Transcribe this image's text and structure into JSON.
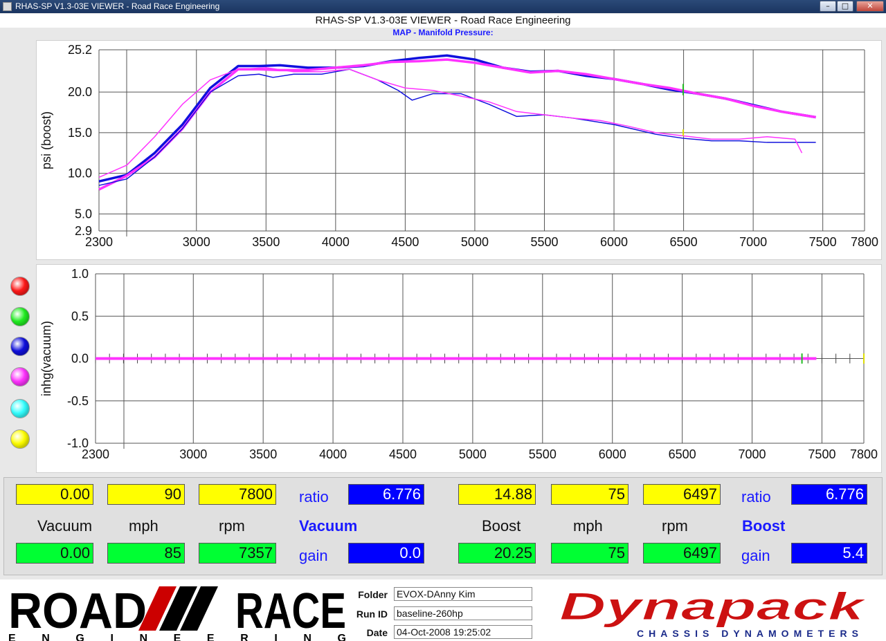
{
  "window": {
    "title": "RHAS-SP V1.3-03E VIEWER - Road Race Engineering",
    "icon": "app-icon",
    "controls": [
      "minimize",
      "maximize",
      "close"
    ]
  },
  "header": {
    "title": "RHAS-SP V1.3-03E VIEWER - Road Race Engineering",
    "subtitle": "MAP - Manifold Pressure:"
  },
  "legend_swatches": [
    {
      "color": "#ff1a1a",
      "name": "red"
    },
    {
      "color": "#22ee22",
      "name": "green"
    },
    {
      "color": "#1010dd",
      "name": "blue"
    },
    {
      "color": "#ff33ff",
      "name": "magenta"
    },
    {
      "color": "#33ffff",
      "name": "cyan"
    },
    {
      "color": "#ffff00",
      "name": "yellow"
    }
  ],
  "chart_data": [
    {
      "type": "line",
      "title": "MAP - Manifold Pressure:",
      "ylabel": "psi (boost)",
      "xlabel": "",
      "xlim": [
        2300,
        7800
      ],
      "ylim": [
        2.9,
        25.2
      ],
      "xticks": [
        "2300",
        "3000",
        "3500",
        "4000",
        "4500",
        "5000",
        "5500",
        "6000",
        "6500",
        "7000",
        "7500",
        "7800"
      ],
      "yticks": [
        "25.2",
        "20.0",
        "15.0",
        "10.0",
        "5.0",
        "2.9"
      ],
      "grid": true,
      "series": [
        {
          "color": "#1010dd",
          "width": 3.5,
          "x": [
            2300,
            2500,
            2700,
            2900,
            3100,
            3300,
            3450,
            3600,
            3800,
            4000,
            4200,
            4400,
            4600,
            4800,
            5000,
            5200,
            5400,
            5600,
            5800,
            6000,
            6200,
            6400,
            6600,
            6800,
            7000,
            7200,
            7450
          ],
          "y": [
            9.0,
            9.8,
            12.5,
            16.0,
            20.5,
            23.2,
            23.2,
            23.3,
            23.0,
            23.0,
            23.2,
            23.8,
            24.2,
            24.5,
            24.0,
            23.0,
            22.5,
            22.6,
            22.0,
            21.6,
            21.0,
            20.3,
            19.8,
            19.2,
            18.4,
            17.6,
            16.9
          ]
        },
        {
          "color": "#ff33ff",
          "width": 3.5,
          "x": [
            2300,
            2500,
            2700,
            2900,
            3100,
            3300,
            3450,
            3600,
            3800,
            4000,
            4200,
            4400,
            4600,
            4800,
            5000,
            5200,
            5400,
            5600,
            5800,
            6000,
            6200,
            6400,
            6600,
            6800,
            7000,
            7200,
            7450
          ],
          "y": [
            8.0,
            9.7,
            12.0,
            15.5,
            20.0,
            22.8,
            22.8,
            22.7,
            22.7,
            23.0,
            23.3,
            23.7,
            23.8,
            24.0,
            23.6,
            23.0,
            22.4,
            22.6,
            22.2,
            21.6,
            21.0,
            20.5,
            19.8,
            19.2,
            18.3,
            17.6,
            16.9
          ]
        },
        {
          "color": "#1010dd",
          "width": 1.5,
          "x": [
            2300,
            2500,
            2700,
            2900,
            3100,
            3300,
            3450,
            3550,
            3700,
            3900,
            4100,
            4300,
            4450,
            4550,
            4700,
            4900,
            5100,
            5300,
            5500,
            5700,
            6000,
            6300,
            6500,
            6700,
            6900,
            7100,
            7300,
            7450
          ],
          "y": [
            8.5,
            9.3,
            12.0,
            15.5,
            20.0,
            22.0,
            22.2,
            21.8,
            22.2,
            22.2,
            22.8,
            21.5,
            20.2,
            19.0,
            19.8,
            19.8,
            18.5,
            17.0,
            17.2,
            16.8,
            16.0,
            14.8,
            14.3,
            14.0,
            14.0,
            13.8,
            13.8,
            13.8
          ]
        },
        {
          "color": "#ff33ff",
          "width": 1.5,
          "x": [
            2300,
            2500,
            2700,
            2900,
            3100,
            3300,
            3500,
            3700,
            3900,
            4100,
            4300,
            4500,
            4700,
            4900,
            5100,
            5300,
            5500,
            5700,
            5900,
            6100,
            6300,
            6500,
            6700,
            6900,
            7100,
            7300,
            7350
          ],
          "y": [
            9.5,
            11.0,
            14.5,
            18.5,
            21.5,
            22.8,
            23.0,
            22.5,
            22.5,
            22.8,
            21.5,
            20.5,
            20.2,
            19.5,
            18.8,
            17.6,
            17.2,
            16.8,
            16.5,
            15.8,
            15.0,
            14.6,
            14.2,
            14.2,
            14.5,
            14.2,
            12.5
          ]
        }
      ],
      "markers": [
        {
          "color": "#22bb22",
          "x": 6497,
          "y0": 19.6,
          "y1": 21.0
        },
        {
          "color": "#dddd00",
          "x": 6497,
          "y0": 14.6,
          "y1": 15.4
        }
      ]
    },
    {
      "type": "line",
      "ylabel": "inhg(vacuum)",
      "xlabel": "",
      "xlim": [
        2300,
        7800
      ],
      "ylim": [
        -1.0,
        1.0
      ],
      "xticks": [
        "2300",
        "3000",
        "3500",
        "4000",
        "4500",
        "5000",
        "5500",
        "6000",
        "6500",
        "7000",
        "7500",
        "7800"
      ],
      "yticks": [
        "1.0",
        "0.5",
        "0.0",
        "-0.5",
        "-1.0"
      ],
      "grid": true,
      "series": [
        {
          "color": "#ff33ff",
          "width": 4,
          "x": [
            2300,
            7460
          ],
          "y": [
            0.0,
            0.0
          ]
        }
      ],
      "markers": [
        {
          "color": "#22bb22",
          "x": 7357,
          "y0": -0.06,
          "y1": 0.06
        },
        {
          "color": "#dddd00",
          "x": 7800,
          "y0": -0.06,
          "y1": 0.06
        }
      ]
    }
  ],
  "readout": {
    "vacuum": {
      "value": "0.00",
      "mph": "90",
      "rpm": "7800",
      "ratio_label": "ratio",
      "ratio": "6.776",
      "cur_vacuum": "0.00",
      "cur_mph": "85",
      "cur_rpm": "7357",
      "gain_label": "gain",
      "gain": "0.0"
    },
    "boost": {
      "value": "14.88",
      "mph": "75",
      "rpm": "6497",
      "ratio_label": "ratio",
      "ratio": "6.776",
      "cur_boost": "20.25",
      "cur_mph": "75",
      "cur_rpm": "6497",
      "gain_label": "gain",
      "gain": "5.4"
    },
    "labels": {
      "vacuum": "Vacuum",
      "mph": "mph",
      "rpm": "rpm",
      "vacuum_title": "Vacuum",
      "boost": "Boost",
      "mph2": "mph",
      "rpm2": "rpm",
      "boost_title": "Boost"
    }
  },
  "footer": {
    "rre_logo": {
      "word1": "ROAD",
      "word2": "RACE",
      "sub": "E N G I N E E R I N G"
    },
    "folder_label": "Folder",
    "folder": "EVOX-DAnny Kim",
    "runid_label": "Run ID",
    "runid": "baseline-260hp",
    "date_label": "Date",
    "date": "04-Oct-2008  19:25:02",
    "dynapack": {
      "word": "Dynapack",
      "sub": "CHASSIS  DYNAMOMETERS"
    }
  }
}
